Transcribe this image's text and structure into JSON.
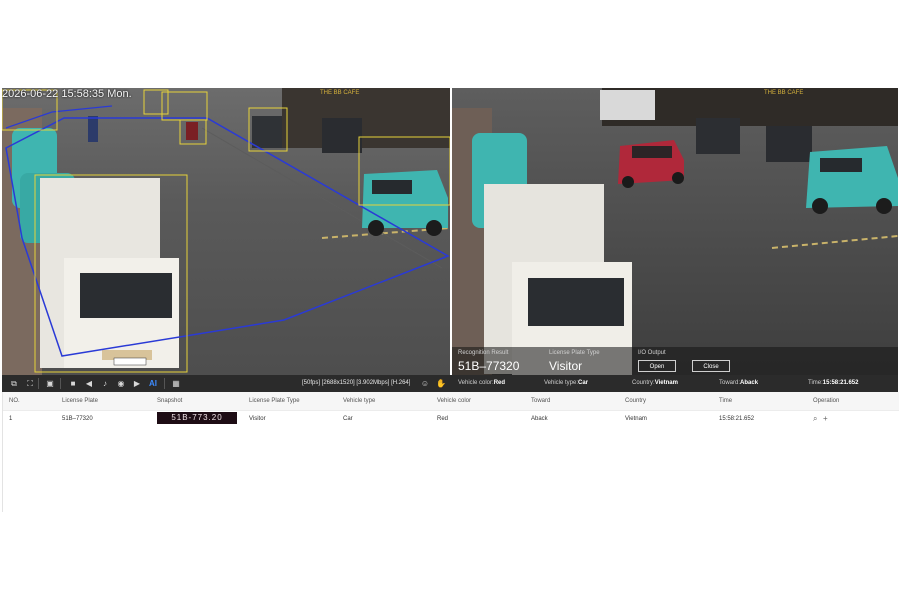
{
  "live_view": {
    "timestamp": "2026-06-22 15:58:35 Mon.",
    "shop_sign": "THE BB CAFE",
    "truck_plate": "51B-77320"
  },
  "snapshot_view": {
    "shop_sign": "THE BB CAFE",
    "truck_plate": "51B-77320"
  },
  "overlay": {
    "recognition_label": "Recognition Result",
    "recognition_value": "51B–77320",
    "plate_type_label": "License Plate Type",
    "plate_type_value": "Visitor",
    "io_label": "I/O Output",
    "open_label": "Open",
    "close_label": "Close"
  },
  "toolbar": {
    "stream_info": "[50fps] [2688x1520] [3.902Mbps] [H.264]",
    "ai_label": "AI",
    "vehicle_color_label": "Vehicle color:",
    "vehicle_color_value": "Red",
    "vehicle_type_label": "Vehicle type:",
    "vehicle_type_value": "Car",
    "country_label": "Country:",
    "country_value": "Vietnam",
    "toward_label": "Toward:",
    "toward_value": "Aback",
    "time_label": "Time:",
    "time_value": "15:58:21.652",
    "icons": [
      "picture-in-picture-icon",
      "fullscreen-icon",
      "window-split-icon",
      "stop-icon",
      "volume-icon",
      "microphone-icon",
      "snapshot-camera-icon",
      "record-icon",
      "ai-icon",
      "grid-icon",
      "person-detect-icon",
      "hand-icon"
    ]
  },
  "table": {
    "headers": [
      "NO.",
      "License Plate",
      "Snapshot",
      "License Plate Type",
      "Vehicle type",
      "Vehicle color",
      "Toward",
      "Country",
      "Time",
      "Operation"
    ],
    "rows": [
      {
        "no": "1",
        "license_plate": "51B–77320",
        "snapshot_text": "51B-773.20",
        "plate_type": "Visitor",
        "vehicle_type": "Car",
        "vehicle_color": "Red",
        "toward": "Aback",
        "country": "Vietnam",
        "time": "15:58:21.652"
      }
    ]
  },
  "colors": {
    "detection_box": "#e6d23a",
    "zone_line": "#2a3ad6",
    "toolbar_bg": "#2b2b2b",
    "taxi_teal": "#3fb5b0",
    "red_car": "#b0283a"
  }
}
